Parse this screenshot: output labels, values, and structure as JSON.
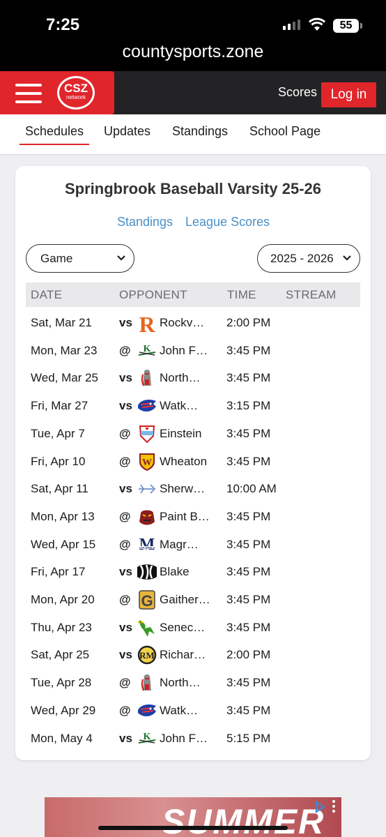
{
  "status_bar": {
    "time": "7:25",
    "battery": "55"
  },
  "browser": {
    "url": "countysports.zone"
  },
  "header": {
    "logo_text": "CSZ",
    "logo_subtext": "network",
    "scores_label": "Scores",
    "login_label": "Log in",
    "brand_color": "#e0262b"
  },
  "nav": {
    "items": [
      {
        "label": "Schedules",
        "active": true
      },
      {
        "label": "Updates"
      },
      {
        "label": "Standings"
      },
      {
        "label": "School Page"
      }
    ]
  },
  "card": {
    "title": "Springbrook Baseball Varsity 25-26",
    "links": [
      "Standings",
      "League Scores"
    ],
    "filter_select": "Game",
    "season_select": "2025 - 2026",
    "columns": [
      "DATE",
      "OPPONENT",
      "TIME",
      "STREAM"
    ]
  },
  "games": [
    {
      "date": "Sat, Mar 21",
      "ha": "vs",
      "opponent": "Rockv…",
      "time": "2:00 PM",
      "logo": "rockville-r-logo-icon"
    },
    {
      "date": "Mon, Mar 23",
      "ha": "@",
      "opponent": "John F…",
      "time": "3:45 PM",
      "logo": "kennedy-k-logo-icon"
    },
    {
      "date": "Wed, Mar 25",
      "ha": "vs",
      "opponent": "North…",
      "time": "3:45 PM",
      "logo": "knight-logo-icon"
    },
    {
      "date": "Fri, Mar 27",
      "ha": "vs",
      "opponent": "Watk…",
      "time": "3:15 PM",
      "logo": "wolverine-logo-icon"
    },
    {
      "date": "Tue, Apr 7",
      "ha": "@",
      "opponent": "Einstein",
      "time": "3:45 PM",
      "logo": "titans-shield-logo-icon"
    },
    {
      "date": "Fri, Apr 10",
      "ha": "@",
      "opponent": "Wheaton",
      "time": "3:45 PM",
      "logo": "wheaton-w-logo-icon"
    },
    {
      "date": "Sat, Apr 11",
      "ha": "vs",
      "opponent": "Sherw…",
      "time": "10:00 AM",
      "logo": "arrow-logo-icon"
    },
    {
      "date": "Mon, Apr 13",
      "ha": "@",
      "opponent": "Paint B…",
      "time": "3:45 PM",
      "logo": "panther-logo-icon"
    },
    {
      "date": "Wed, Apr 15",
      "ha": "@",
      "opponent": "Magr…",
      "time": "3:45 PM",
      "logo": "colonels-m-logo-icon"
    },
    {
      "date": "Fri, Apr 17",
      "ha": "vs",
      "opponent": "Blake",
      "time": "3:45 PM",
      "logo": "bengal-stripes-logo-icon"
    },
    {
      "date": "Mon, Apr 20",
      "ha": "@",
      "opponent": "Gaither…",
      "time": "3:45 PM",
      "logo": "gaithersburg-g-logo-icon"
    },
    {
      "date": "Thu, Apr 23",
      "ha": "vs",
      "opponent": "Senec…",
      "time": "3:45 PM",
      "logo": "screaming-eagle-logo-icon"
    },
    {
      "date": "Sat, Apr 25",
      "ha": "vs",
      "opponent": "Richar…",
      "time": "2:00 PM",
      "logo": "richard-montgomery-logo-icon"
    },
    {
      "date": "Tue, Apr 28",
      "ha": "@",
      "opponent": "North…",
      "time": "3:45 PM",
      "logo": "knight-logo-icon"
    },
    {
      "date": "Wed, Apr 29",
      "ha": "@",
      "opponent": "Watk…",
      "time": "3:45 PM",
      "logo": "wolverine-logo-icon"
    },
    {
      "date": "Mon, May 4",
      "ha": "vs",
      "opponent": "John F…",
      "time": "5:15 PM",
      "logo": "kennedy-k-logo-icon"
    }
  ],
  "ad": {
    "text": "SUMMER"
  }
}
